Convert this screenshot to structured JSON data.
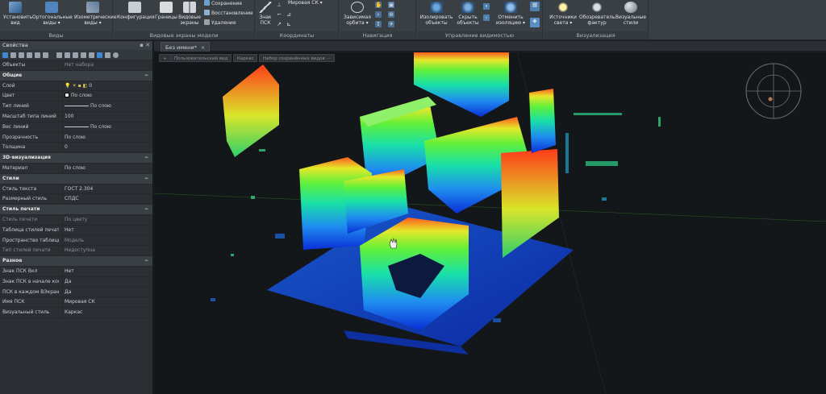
{
  "ribbon": {
    "groups": [
      {
        "title": "Виды",
        "buttons": [
          "Установить вид",
          "Ортогональные виды ▾",
          "Изометрические виды ▾"
        ]
      },
      {
        "title": "Видовые экраны модели",
        "buttons": [
          "Конфигурация",
          "Границы",
          "Видовые экраны"
        ],
        "small": [
          "Сохранение",
          "Восстановление",
          "Удаление"
        ]
      },
      {
        "title": "Координаты",
        "buttons": [
          "Знак ПСК"
        ],
        "dropdown": "Мировая СК"
      },
      {
        "title": "Навигация",
        "buttons": [
          "Зависимая орбита ▾"
        ]
      },
      {
        "title": "Управление видимостью",
        "buttons": [
          "Изолировать объекты",
          "Скрыть объекты",
          "Отменить изоляцию ▾"
        ]
      },
      {
        "title": "Визуализация",
        "buttons": [
          "Источники света ▾",
          "Обозреватель фактур",
          "Визуальные стили"
        ]
      }
    ]
  },
  "properties": {
    "title": "Свойства",
    "rows": [
      {
        "type": "row",
        "name": "Объекты",
        "value": "Нет набора",
        "dim": true
      },
      {
        "type": "sec",
        "name": "Общие"
      },
      {
        "type": "row",
        "name": "Слой",
        "value": "0",
        "layer": true
      },
      {
        "type": "row",
        "name": "Цвет",
        "value": "По слою",
        "swatch": true
      },
      {
        "type": "row",
        "name": "Тип линий",
        "value": "По слою",
        "line": true
      },
      {
        "type": "row",
        "name": "Масштаб типа линий",
        "value": "100"
      },
      {
        "type": "row",
        "name": "Вес линий",
        "value": "По слою",
        "line": true
      },
      {
        "type": "row",
        "name": "Прозрачность",
        "value": "По слою"
      },
      {
        "type": "row",
        "name": "Толщина",
        "value": "0"
      },
      {
        "type": "sec",
        "name": "3D-визуализация"
      },
      {
        "type": "row",
        "name": "Материал",
        "value": "По слою"
      },
      {
        "type": "sec",
        "name": "Стили"
      },
      {
        "type": "row",
        "name": "Стиль текста",
        "value": "ГОСТ 2.304"
      },
      {
        "type": "row",
        "name": "Размерный стиль",
        "value": "СПДС"
      },
      {
        "type": "sec",
        "name": "Стиль печати"
      },
      {
        "type": "row",
        "name": "Стиль печати",
        "value": "По цвету",
        "dimall": true
      },
      {
        "type": "row",
        "name": "Таблица стилей печати",
        "value": "Нет"
      },
      {
        "type": "row",
        "name": "Пространство таблицы с...",
        "value": "Модель",
        "dimv": true
      },
      {
        "type": "row",
        "name": "Тип стилей печати",
        "value": "Недоступна",
        "dimall": true
      },
      {
        "type": "sec",
        "name": "Разное"
      },
      {
        "type": "row",
        "name": "Знак ПСК Вкл",
        "value": "Нет"
      },
      {
        "type": "row",
        "name": "Знак ПСК в начале коор...",
        "value": "Да"
      },
      {
        "type": "row",
        "name": "ПСК в каждом ВЭкране",
        "value": "Да"
      },
      {
        "type": "row",
        "name": "Имя ПСК",
        "value": "Мировая СК"
      },
      {
        "type": "row",
        "name": "Визуальный стиль",
        "value": "Каркас"
      }
    ]
  },
  "doc_tab": {
    "label": "Без имени*",
    "close": "×"
  },
  "view_tabs": [
    "+",
    "Пользовательский вид",
    "Каркас",
    "Набор сохранённых видов ···"
  ],
  "colors": {
    "accent": "#2f7fd6",
    "panel": "#2b2f33",
    "ribbon": "#3a3f44",
    "viewport": "#141719"
  }
}
